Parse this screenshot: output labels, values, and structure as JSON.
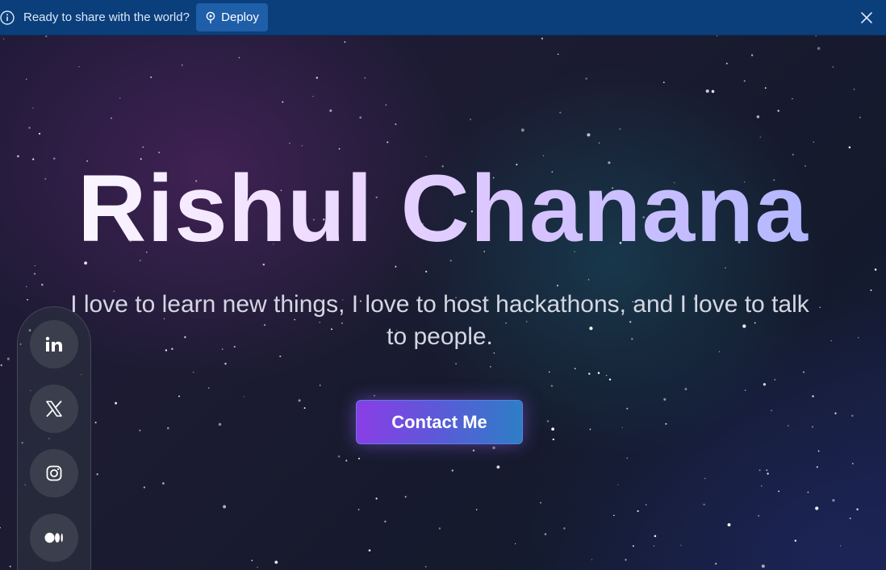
{
  "banner": {
    "message": "Ready to share with the world?",
    "deploy_label": "Deploy",
    "icons": [
      "info-icon",
      "deploy-icon",
      "close-icon"
    ],
    "background": "#0b3f7c"
  },
  "hero": {
    "name": "Rishul Chanana",
    "tagline": "I love to learn new things, I love to host hackathons, and I love to talk to people.",
    "cta_label": "Contact Me",
    "cta_gradient": [
      "#8a3de6",
      "#2d7ec6"
    ]
  },
  "social": {
    "items": [
      {
        "name": "linkedin",
        "icon": "linkedin-icon"
      },
      {
        "name": "x",
        "icon": "x-icon"
      },
      {
        "name": "instagram",
        "icon": "instagram-icon"
      },
      {
        "name": "medium",
        "icon": "medium-icon"
      }
    ]
  }
}
